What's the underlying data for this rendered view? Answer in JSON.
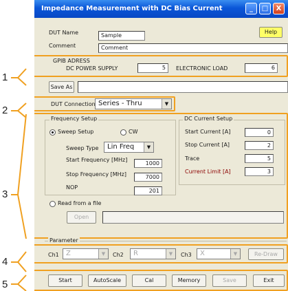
{
  "window": {
    "title": "Impedance Measurement with DC Bias Current",
    "min_glyph": "_",
    "max_glyph": "□",
    "close_glyph": "X"
  },
  "colors": {
    "highlight": "#f0a020",
    "accent_text": "#8b0000",
    "help_button": "#ffff66",
    "titlebar": "#0a56d8"
  },
  "header": {
    "dut_name_label": "DUT Name",
    "dut_name_value": "Sample",
    "comment_label": "Comment",
    "comment_value": "Comment",
    "help": "Help"
  },
  "gpib": {
    "title": "GPIB ADRESS",
    "dc_power_label": "DC POWER SUPPLY",
    "dc_power_value": "5",
    "eload_label": "ELECTRONIC LOAD",
    "eload_value": "6"
  },
  "save": {
    "button": "Save As",
    "path": ""
  },
  "dut_connection": {
    "label": "DUT Connection",
    "value": "Series - Thru"
  },
  "frequency": {
    "title": "Frequency Setup",
    "sweep_label": "Sweep Setup",
    "cw_label": "CW",
    "sweep_type_label": "Sweep Type",
    "sweep_type_value": "Lin Freq",
    "start_label": "Start Frequency [MHz]",
    "start_value": "1000",
    "stop_label": "Stop Frequency [MHz]",
    "stop_value": "7000",
    "nop_label": "NOP",
    "nop_value": "201"
  },
  "dc_current": {
    "title": "DC Current Setup",
    "start_label": "Start Current [A]",
    "start_value": "0",
    "stop_label": "Stop Current [A]",
    "stop_value": "2",
    "trace_label": "Trace",
    "trace_value": "5",
    "limit_label": "Current Limit [A]",
    "limit_value": "3"
  },
  "file": {
    "read_label": "Read from a file",
    "open_button": "Open",
    "path": ""
  },
  "parameter": {
    "title": "Parameter",
    "ch1_label": "Ch1",
    "ch1_value": "Z",
    "ch2_label": "Ch2",
    "ch2_value": "R",
    "ch3_label": "Ch3",
    "ch3_value": "X",
    "redraw": "Re-Draw"
  },
  "toolbar": {
    "start": "Start",
    "autoscale": "AutoScale",
    "cal": "Cal",
    "memory": "Memory",
    "save": "Save",
    "exit": "Exit"
  },
  "callouts": [
    "1",
    "2",
    "3",
    "4",
    "5"
  ]
}
